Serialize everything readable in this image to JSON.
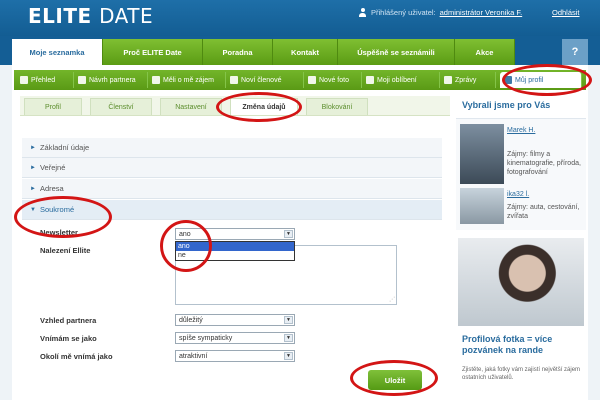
{
  "brand": {
    "logo_bold": "ELITE",
    "logo_light": "DATE"
  },
  "user": {
    "label": "Přihlášený uživatel:",
    "name": "administrátor Veronika F.",
    "logout": "Odhlásit"
  },
  "mainnav": [
    "Moje seznamka",
    "Proč ELITE Date",
    "Poradna",
    "Kontakt",
    "Úspěšně se seznámili",
    "Akce"
  ],
  "help": "?",
  "subnav": [
    "Přehled",
    "Návrh partnera",
    "Měli o mě zájem",
    "Noví členové",
    "Nové foto",
    "Moji oblíbení",
    "Zprávy",
    "Můj profil"
  ],
  "profile_tabs": [
    "Profil",
    "Členství",
    "Nastavení",
    "Změna údajů",
    "Blokování"
  ],
  "sections": [
    "Základní údaje",
    "Veřejné",
    "Adresa",
    "Soukromé"
  ],
  "form": {
    "newsletter_label": "Newsletter",
    "newsletter_value": "ano",
    "newsletter_options": [
      "ano",
      "ne"
    ],
    "nalezeni_label": "Nalezení Ellite",
    "vzhled_label": "Vzhled partnera",
    "vzhled_value": "důležitý",
    "vnimam_label": "Vnímám se jako",
    "vnimam_value": "spíše sympaticky",
    "okoli_label": "Okolí mě vnímá jako",
    "okoli_value": "atraktivní",
    "save": "Uložit"
  },
  "sidebar": {
    "title": "Vybrali jsme pro Vás",
    "people": [
      {
        "name": "Marek H.",
        "text": "Zájmy: filmy a kinematografie, příroda, fotografování"
      },
      {
        "name": "ika32 l.",
        "text": "Zájmy: auta, cestování, zvířata"
      }
    ],
    "promo_title": "Profilová fotka = více pozvánek na rande",
    "promo_text": "Zjistěte, jaká fotky vám zajistí největší zájem ostatních uživatelů."
  }
}
